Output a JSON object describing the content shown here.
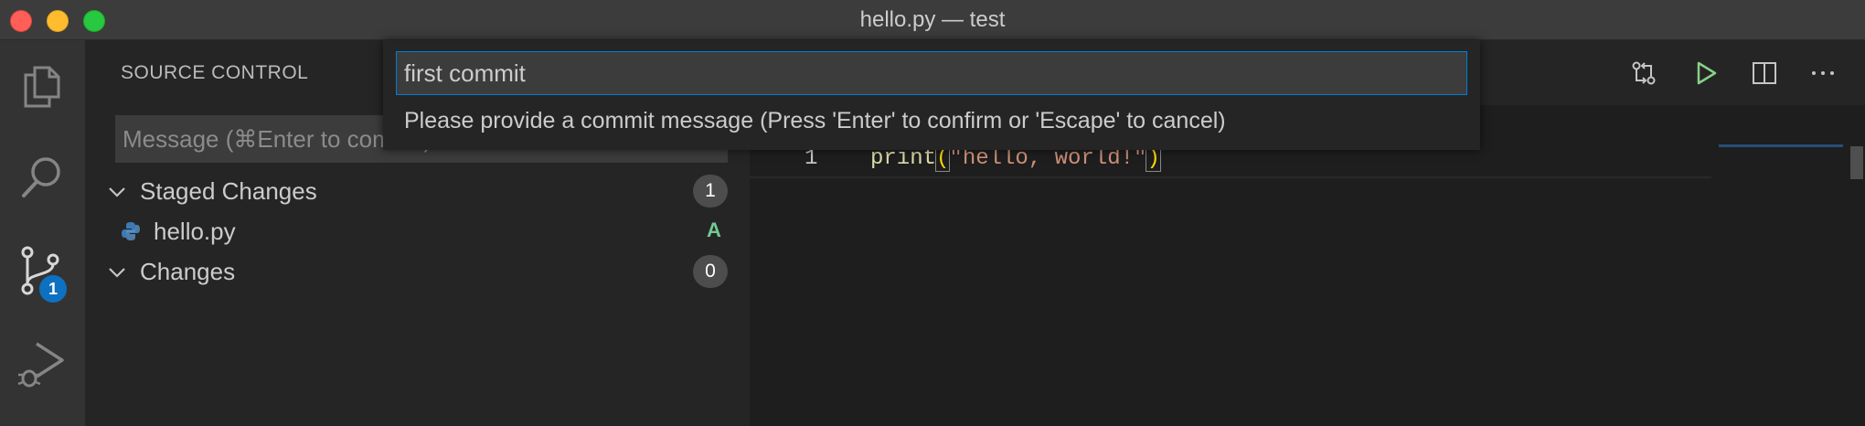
{
  "window": {
    "title": "hello.py — test"
  },
  "activity_bar": {
    "items": [
      {
        "name": "explorer",
        "icon": "files-icon"
      },
      {
        "name": "search",
        "icon": "search-icon"
      },
      {
        "name": "source-control",
        "icon": "source-control-icon",
        "badge": "1"
      },
      {
        "name": "run-and-debug",
        "icon": "debug-icon"
      }
    ]
  },
  "sidebar": {
    "title": "SOURCE CONTROL",
    "commit_placeholder": "Message (⌘Enter to commit)",
    "groups": [
      {
        "label": "Staged Changes",
        "count": "1",
        "files": [
          {
            "name": "hello.py",
            "status": "A"
          }
        ]
      },
      {
        "label": "Changes",
        "count": "0",
        "files": []
      }
    ]
  },
  "quick_input": {
    "value": "first commit",
    "message": "Please provide a commit message (Press 'Enter' to confirm or 'Escape' to cancel)"
  },
  "editor": {
    "line_number": "1",
    "code": {
      "fn": "print",
      "open_paren": "(",
      "string": "\"hello, world!\"",
      "close_paren": ")"
    },
    "actions": [
      "compare-changes-icon",
      "run-icon",
      "split-editor-icon",
      "more-actions-icon"
    ]
  },
  "colors": {
    "accent": "#007fd4",
    "badge": "#0e70c0",
    "added": "#73c991",
    "run": "#89d185"
  }
}
